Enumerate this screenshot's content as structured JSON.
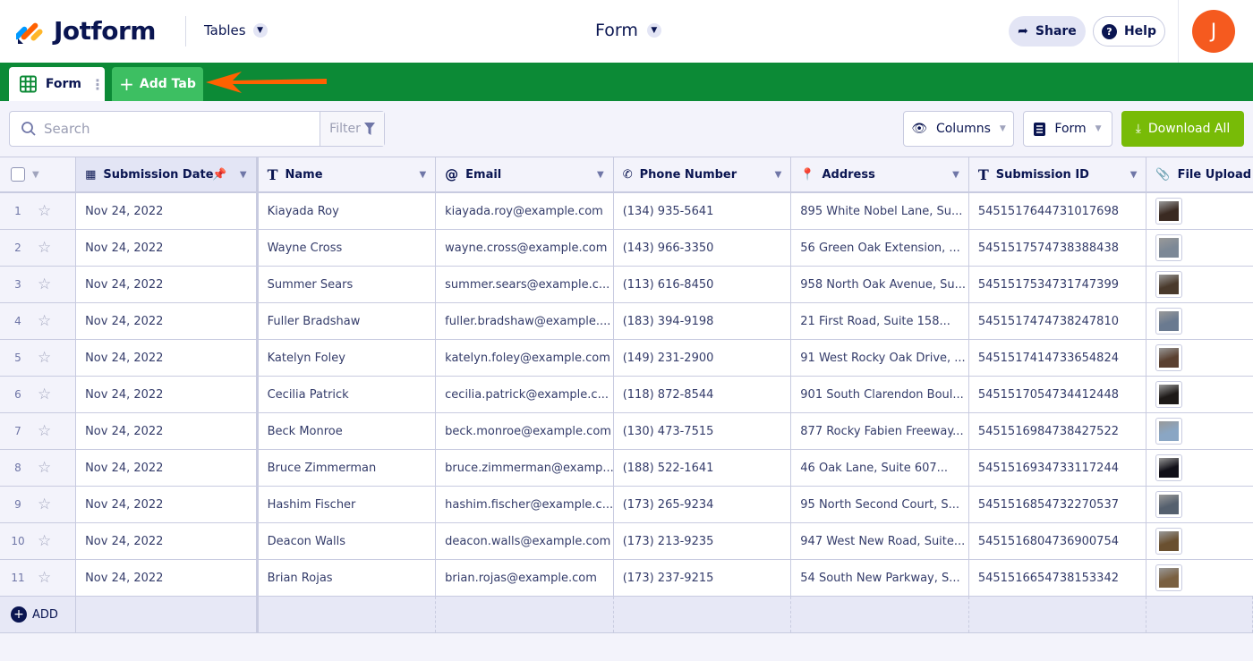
{
  "header": {
    "logo": "Jotform",
    "product_menu": "Tables",
    "form_title": "Form",
    "share": "Share",
    "help": "Help",
    "avatar_initial": "J"
  },
  "tabs": {
    "active": "Form",
    "add": "Add Tab"
  },
  "toolbar": {
    "search_placeholder": "Search",
    "filter": "Filter",
    "columns": "Columns",
    "form": "Form",
    "download": "Download All"
  },
  "colors": {
    "brand_green": "#0c8a36",
    "add_tab": "#3dbf62",
    "download": "#78bb07",
    "avatar": "#f55a1f",
    "arrow": "#ff6100"
  },
  "columns": [
    "Submission Date",
    "Name",
    "Email",
    "Phone Number",
    "Address",
    "Submission ID",
    "File Upload"
  ],
  "rows": [
    {
      "n": "1",
      "date": "Nov 24, 2022",
      "name": "Kiayada Roy",
      "email": "kiayada.roy@example.com",
      "phone": "(134) 935-5641",
      "address": "895 White Nobel Lane, Su...",
      "id": "5451517644731017698",
      "thumb": "#3a2a22"
    },
    {
      "n": "2",
      "date": "Nov 24, 2022",
      "name": "Wayne Cross",
      "email": "wayne.cross@example.com",
      "phone": "(143) 966-3350",
      "address": "56 Green Oak Extension, ...",
      "id": "5451517574738388438",
      "thumb": "#7c8896"
    },
    {
      "n": "3",
      "date": "Nov 24, 2022",
      "name": "Summer Sears",
      "email": "summer.sears@example.c...",
      "phone": "(113) 616-8450",
      "address": "958 North Oak Avenue, Su...",
      "id": "5451517534731747399",
      "thumb": "#4a3a2c"
    },
    {
      "n": "4",
      "date": "Nov 24, 2022",
      "name": "Fuller Bradshaw",
      "email": "fuller.bradshaw@example....",
      "phone": "(183) 394-9198",
      "address": "21 First Road, Suite 158...",
      "id": "5451517474738247810",
      "thumb": "#6a7a90"
    },
    {
      "n": "5",
      "date": "Nov 24, 2022",
      "name": "Katelyn Foley",
      "email": "katelyn.foley@example.com",
      "phone": "(149) 231-2900",
      "address": "91 West Rocky Oak Drive, ...",
      "id": "5451517414733654824",
      "thumb": "#5a4030"
    },
    {
      "n": "6",
      "date": "Nov 24, 2022",
      "name": "Cecilia Patrick",
      "email": "cecilia.patrick@example.c...",
      "phone": "(118) 872-8544",
      "address": "901 South Clarendon Boul...",
      "id": "5451517054734412448",
      "thumb": "#1e1a18"
    },
    {
      "n": "7",
      "date": "Nov 24, 2022",
      "name": "Beck Monroe",
      "email": "beck.monroe@example.com",
      "phone": "(130) 473-7515",
      "address": "877 Rocky Fabien Freeway...",
      "id": "5451516984738427522",
      "thumb": "#8aa6c4"
    },
    {
      "n": "8",
      "date": "Nov 24, 2022",
      "name": "Bruce Zimmerman",
      "email": "bruce.zimmerman@examp...",
      "phone": "(188) 522-1641",
      "address": "46 Oak Lane, Suite 607...",
      "id": "5451516934733117244",
      "thumb": "#111018"
    },
    {
      "n": "9",
      "date": "Nov 24, 2022",
      "name": "Hashim Fischer",
      "email": "hashim.fischer@example.c...",
      "phone": "(173) 265-9234",
      "address": "95 North Second Court, S...",
      "id": "5451516854732270537",
      "thumb": "#55606e"
    },
    {
      "n": "10",
      "date": "Nov 24, 2022",
      "name": "Deacon Walls",
      "email": "deacon.walls@example.com",
      "phone": "(173) 213-9235",
      "address": "947 West New Road, Suite...",
      "id": "5451516804736900754",
      "thumb": "#6a5030"
    },
    {
      "n": "11",
      "date": "Nov 24, 2022",
      "name": "Brian Rojas",
      "email": "brian.rojas@example.com",
      "phone": "(173) 237-9215",
      "address": "54 South New Parkway, S...",
      "id": "5451516654738153342",
      "thumb": "#7a6040"
    }
  ],
  "add_row": "ADD"
}
